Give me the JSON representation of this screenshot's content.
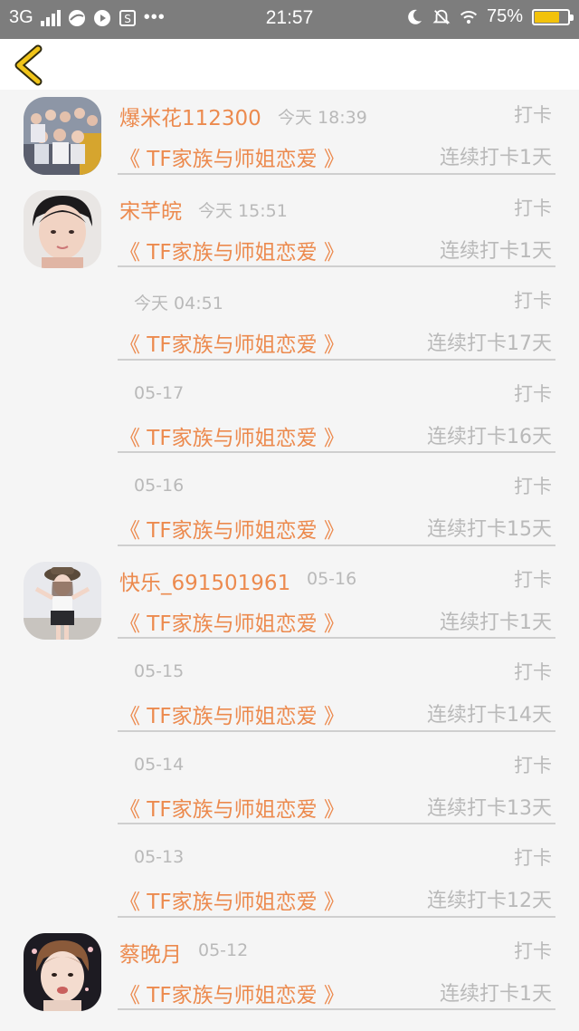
{
  "status_bar": {
    "network": "3G",
    "time": "21:57",
    "battery": "75%",
    "battery_level": 0.75,
    "icons": [
      "signal-icon",
      "browser-icon",
      "play-icon",
      "s-app-icon",
      "more-icon",
      "moon-icon",
      "mute-icon",
      "wifi-icon",
      "battery-icon"
    ]
  },
  "nav": {
    "back_icon": "chevron-left-icon",
    "accent": "#f0c419"
  },
  "colors": {
    "accent_orange": "#ec8a4e",
    "muted_gray": "#b9b9b9"
  },
  "records": [
    {
      "user": "爆米花112300",
      "time": "今天 18:39",
      "action": "打卡",
      "book": "《 TF家族与师姐恋爱 》",
      "streak": "连续打卡1天",
      "avatar": "group-photo-avatar"
    },
    {
      "user": "宋芊皖",
      "time": "今天 15:51",
      "action": "打卡",
      "book": "《 TF家族与师姐恋爱 》",
      "streak": "连续打卡1天",
      "avatar": "girl-avatar"
    },
    {
      "user": "",
      "time": "今天 04:51",
      "action": "打卡",
      "book": "《 TF家族与师姐恋爱 》",
      "streak": "连续打卡17天",
      "avatar": ""
    },
    {
      "user": "",
      "time": "05-17",
      "action": "打卡",
      "book": "《 TF家族与师姐恋爱 》",
      "streak": "连续打卡16天",
      "avatar": ""
    },
    {
      "user": "",
      "time": "05-16",
      "action": "打卡",
      "book": "《 TF家族与师姐恋爱 》",
      "streak": "连续打卡15天",
      "avatar": ""
    },
    {
      "user": "快乐_691501961",
      "time": "05-16",
      "action": "打卡",
      "book": "《 TF家族与师姐恋爱 》",
      "streak": "连续打卡1天",
      "avatar": "hat-girl-avatar"
    },
    {
      "user": "",
      "time": "05-15",
      "action": "打卡",
      "book": "《 TF家族与师姐恋爱 》",
      "streak": "连续打卡14天",
      "avatar": ""
    },
    {
      "user": "",
      "time": "05-14",
      "action": "打卡",
      "book": "《 TF家族与师姐恋爱 》",
      "streak": "连续打卡13天",
      "avatar": ""
    },
    {
      "user": "",
      "time": "05-13",
      "action": "打卡",
      "book": "《 TF家族与师姐恋爱 》",
      "streak": "连续打卡12天",
      "avatar": ""
    },
    {
      "user": "蔡晚月",
      "time": "05-12",
      "action": "打卡",
      "book": "《 TF家族与师姐恋爱 》",
      "streak": "连续打卡1天",
      "avatar": "boy-avatar"
    }
  ]
}
